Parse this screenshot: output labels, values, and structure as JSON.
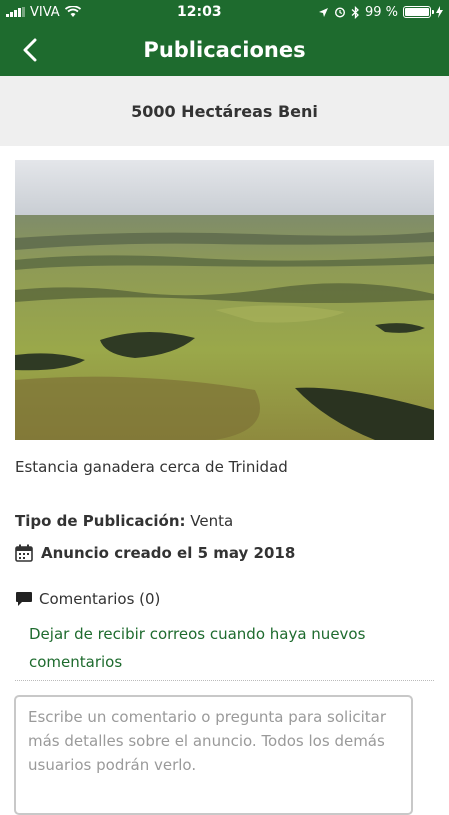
{
  "status_bar": {
    "carrier": "VIVA",
    "time": "12:03",
    "battery_percent": "99 %",
    "battery_level": 0.99
  },
  "nav": {
    "title": "Publicaciones",
    "back_icon": "chevron-left-icon"
  },
  "listing": {
    "title": "5000 Hectáreas Beni",
    "description": "Estancia ganadera cerca de Trinidad",
    "type_label": "Tipo de Publicación:",
    "type_value": "Venta",
    "created_text": "Anuncio creado el 5 may 2018"
  },
  "comments": {
    "label": "Comentarios (0)",
    "unsubscribe_text": "Dejar de recibir correos cuando haya nuevos comentarios",
    "input_placeholder": "Escribe un comentario o pregunta para solicitar más detalles sobre el anuncio. Todos los demás usuarios podrán verlo."
  },
  "colors": {
    "brand_green": "#1e6b2e",
    "subheader_bg": "#efefef"
  }
}
